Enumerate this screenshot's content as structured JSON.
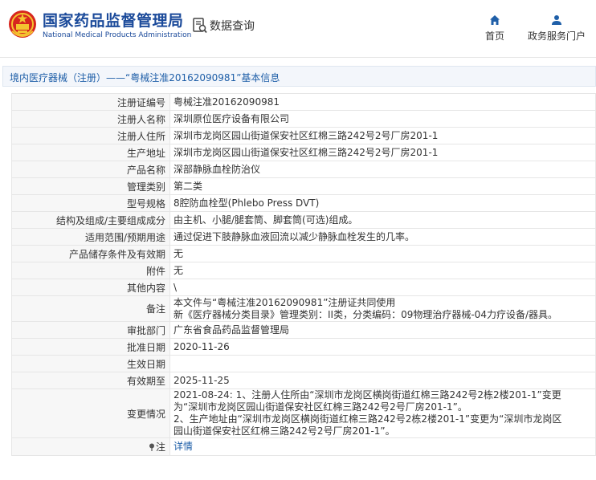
{
  "header": {
    "title_cn": "国家药品监督管理局",
    "title_en": "National Medical Products Administration",
    "data_query": "数据查询",
    "nav_home": "首页",
    "nav_service": "政务服务门户"
  },
  "breadcrumb": "境内医疗器械（注册）——“粤械注准20162090981”基本信息",
  "colors": {
    "brand_blue": "#1b4a9a",
    "link_blue": "#1f5fa8",
    "emblem_red": "#d7261e",
    "emblem_gold": "#f4c430"
  },
  "rows": [
    {
      "label": "注册证编号",
      "value": "粤械注准20162090981"
    },
    {
      "label": "注册人名称",
      "value": "深圳原位医疗设备有限公司"
    },
    {
      "label": "注册人住所",
      "value": "深圳市龙岗区园山街道保安社区红棉三路242号2号厂房201-1"
    },
    {
      "label": "生产地址",
      "value": "深圳市龙岗区园山街道保安社区红棉三路242号2号厂房201-1"
    },
    {
      "label": "产品名称",
      "value": "深部静脉血栓防治仪"
    },
    {
      "label": "管理类别",
      "value": "第二类"
    },
    {
      "label": "型号规格",
      "value": "8腔防血栓型(Phlebo Press DVT)"
    },
    {
      "label": "结构及组成/主要组成成分",
      "value": "由主机、小腿/腿套筒、脚套筒(可选)组成。"
    },
    {
      "label": "适用范围/预期用途",
      "value": "通过促进下肢静脉血液回流以减少静脉血栓发生的几率。"
    },
    {
      "label": "产品储存条件及有效期",
      "value": "无"
    },
    {
      "label": "附件",
      "value": "无"
    },
    {
      "label": "其他内容",
      "value": "\\"
    },
    {
      "label": "备注",
      "value": "本文件与“粤械注准20162090981”注册证共同使用\n新《医疗器械分类目录》管理类别：II类，分类编码：09物理治疗器械-04力疗设备/器具。"
    },
    {
      "label": "审批部门",
      "value": "广东省食品药品监督管理局"
    },
    {
      "label": "批准日期",
      "value": "2020-11-26"
    },
    {
      "label": "生效日期",
      "value": ""
    },
    {
      "label": "有效期至",
      "value": "2025-11-25"
    },
    {
      "label": "变更情况",
      "value": "2021-08-24: 1、注册人住所由“深圳市龙岗区横岗街道红棉三路242号2栋2楼201-1”变更为“深圳市龙岗区园山街道保安社区红棉三路242号2号厂房201-1”。\n2、生产地址由“深圳市龙岗区横岗街道红棉三路242号2栋2楼201-1”变更为“深圳市龙岗区园山街道保安社区红棉三路242号2号厂房201-1”。"
    }
  ],
  "note": {
    "label": "注",
    "link": "详情",
    "icon": "pin-icon"
  }
}
